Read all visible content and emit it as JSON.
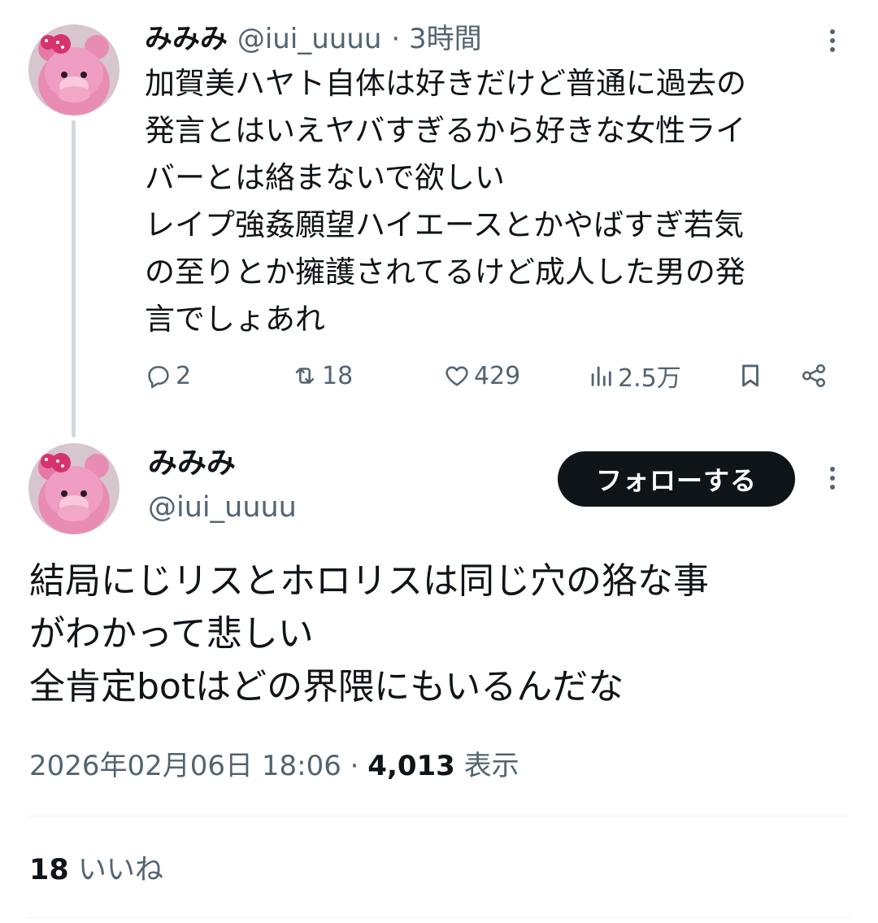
{
  "reply_tweet": {
    "display_name": "みみみ",
    "handle": "@iui_uuuu",
    "time": "· 3時間",
    "text": "加賀美ハヤト自体は好きだけど普通に過去の\n発言とはいえヤバすぎるから好きな女性ライ\nバーとは絡まないで欲しい\nレイプ強姦願望ハイエースとかやばすぎ若気\nの至りとか擁護されてるけど成人した男の発\n言でしょあれ",
    "actions": {
      "replies": "2",
      "reposts": "18",
      "likes": "429",
      "views": "2.5万"
    }
  },
  "main_tweet": {
    "display_name": "みみみ",
    "handle": "@iui_uuuu",
    "follow_label": "フォローする",
    "text": "結局にじリスとホロリスは同じ穴の狢な事\nがわかって悲しい\n全肯定botはどの界隈にもいるんだな",
    "timestamp": "2026年02月06日 18:06",
    "view_count": "4,013",
    "view_label": "表示",
    "like_count": "18",
    "like_label": "いいね"
  },
  "colors": {
    "text": "#0f1419",
    "secondary": "#536471",
    "thread_line": "#cfd9de",
    "follow_bg": "#0f1419",
    "avatar_pink": "#e88cb4"
  }
}
